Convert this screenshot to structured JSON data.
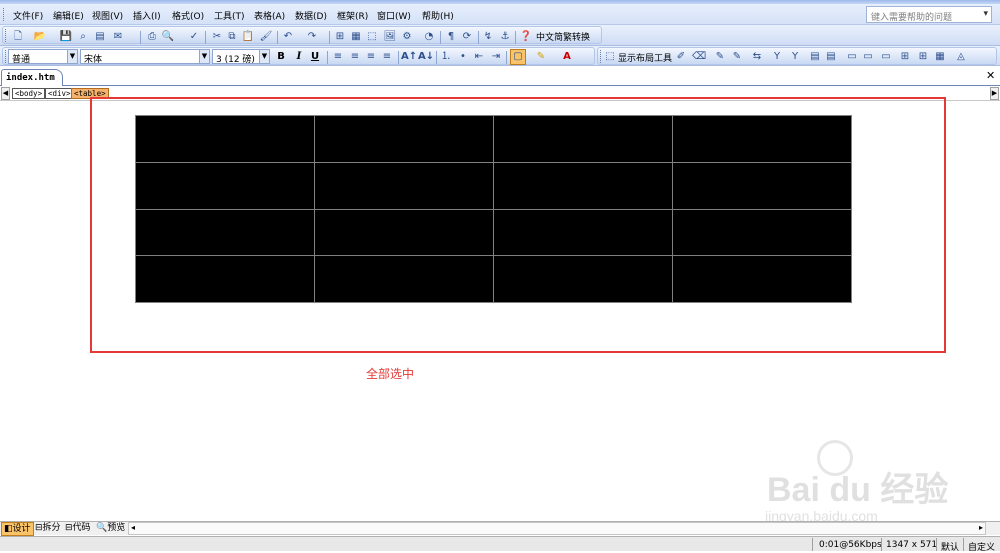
{
  "menu": {
    "items": [
      "文件(F)",
      "编辑(E)",
      "视图(V)",
      "插入(I)",
      "格式(O)",
      "工具(T)",
      "表格(A)",
      "数据(D)",
      "框架(R)",
      "窗口(W)",
      "帮助(H)"
    ],
    "help_placeholder": "键入需要帮助的问题"
  },
  "toolbar1": {
    "chinese_convert_label": "中文简繁转换"
  },
  "toolbar2": {
    "style_value": "普通",
    "font_value": "宋体",
    "size_value": "3 (12 磅)",
    "bold": "B",
    "italic": "I",
    "underline": "U",
    "layout_tools_label": "显示布局工具"
  },
  "document": {
    "tab_label": "index.htm",
    "tags": [
      "<body>",
      "<div>",
      "<table>"
    ],
    "selected_tag": "<table>",
    "table": {
      "rows": 4,
      "cols": 4
    },
    "annotation": "全部选中",
    "accent_color": "#e53935"
  },
  "watermark": {
    "brand": "Bai du 经验",
    "url": "jingyan.baidu.com"
  },
  "view_tabs": {
    "design": "设计",
    "split": "拆分",
    "code": "代码",
    "preview": "预览",
    "active": "设计"
  },
  "status": {
    "download": "0:01@56Kbps",
    "page_size": "1347 x 571",
    "default": "默认",
    "custom": "自定义"
  }
}
